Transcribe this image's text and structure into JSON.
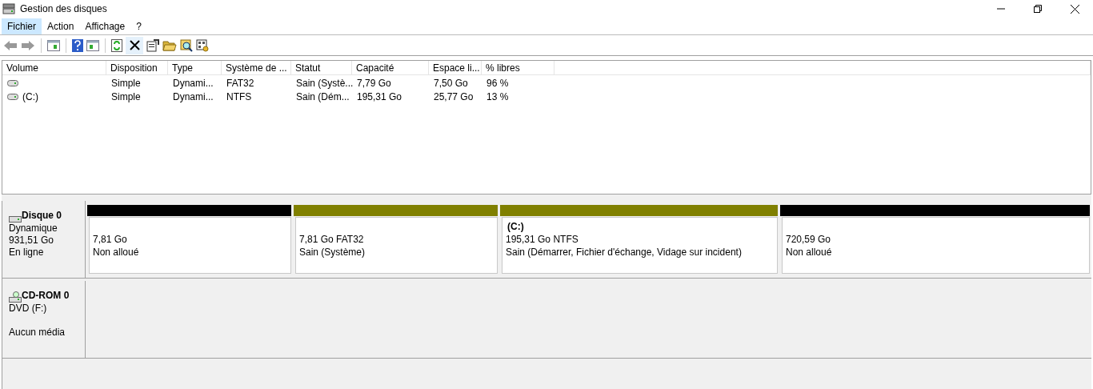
{
  "window": {
    "title": "Gestion des disques"
  },
  "menu": [
    {
      "label": "Fichier",
      "selected": true
    },
    {
      "label": "Action",
      "selected": false
    },
    {
      "label": "Affichage",
      "selected": false
    },
    {
      "label": "?",
      "selected": false
    }
  ],
  "volume_table": {
    "columns": [
      "Volume",
      "Disposition",
      "Type",
      "Système de ...",
      "Statut",
      "Capacité",
      "Espace li...",
      "% libres"
    ],
    "rows": [
      [
        "",
        "Simple",
        "Dynami...",
        "FAT32",
        "Sain (Systè...",
        "7,79 Go",
        "7,50 Go",
        "96 %"
      ],
      [
        "(C:)",
        "Simple",
        "Dynami...",
        "NTFS",
        "Sain (Dém...",
        "195,31 Go",
        "25,77 Go",
        "13 %"
      ]
    ]
  },
  "disks": [
    {
      "kind": "disk",
      "name": "Disque 0",
      "lines": [
        "Dynamique",
        "931,51 Go",
        "En ligne"
      ],
      "partitions": [
        {
          "size": "7,81 Go",
          "status": "Non alloué",
          "color": "#000000"
        },
        {
          "size": "7,81 Go FAT32",
          "status": "Sain (Système)",
          "color": "#808000"
        },
        {
          "name": "(C:)",
          "size": "195,31 Go NTFS",
          "status": "Sain (Démarrer, Fichier d'échange, Vidage sur incident)",
          "color": "#808000"
        },
        {
          "size": "720,59 Go",
          "status": "Non alloué",
          "color": "#000000"
        }
      ]
    },
    {
      "kind": "cdrom",
      "name": "CD-ROM 0",
      "lines": [
        "DVD (F:)",
        "Aucun média"
      ]
    }
  ]
}
